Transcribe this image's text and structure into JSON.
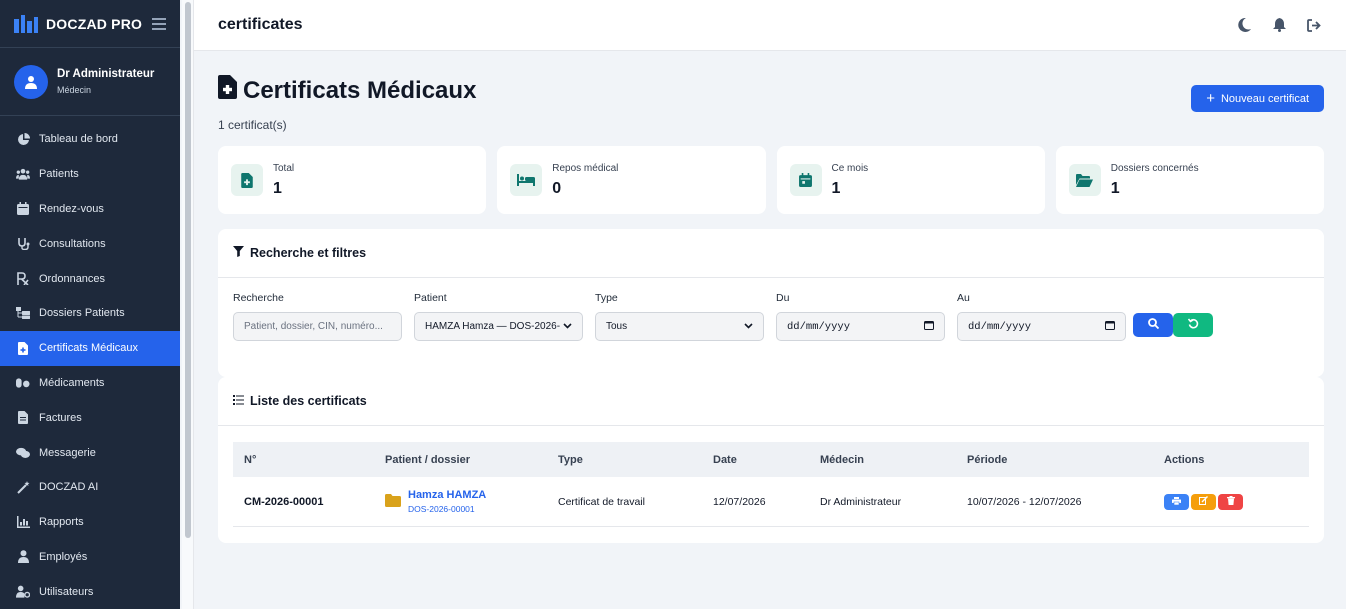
{
  "app": {
    "name": "DOCZAD PRO"
  },
  "user": {
    "name": "Dr Administrateur",
    "role": "Médecin"
  },
  "nav": [
    {
      "label": "Tableau de bord",
      "icon": "chart-pie-icon"
    },
    {
      "label": "Patients",
      "icon": "users-icon"
    },
    {
      "label": "Rendez-vous",
      "icon": "calendar-icon"
    },
    {
      "label": "Consultations",
      "icon": "stethoscope-icon"
    },
    {
      "label": "Ordonnances",
      "icon": "prescription-icon"
    },
    {
      "label": "Dossiers Patients",
      "icon": "folder-tree-icon"
    },
    {
      "label": "Certificats Médicaux",
      "icon": "file-medical-icon",
      "active": true
    },
    {
      "label": "Médicaments",
      "icon": "pills-icon"
    },
    {
      "label": "Factures",
      "icon": "invoice-icon"
    },
    {
      "label": "Messagerie",
      "icon": "comments-icon"
    },
    {
      "label": "DOCZAD AI",
      "icon": "magic-wand-icon"
    },
    {
      "label": "Rapports",
      "icon": "chart-bar-icon"
    },
    {
      "label": "Employés",
      "icon": "user-icon"
    },
    {
      "label": "Utilisateurs",
      "icon": "user-gear-icon"
    }
  ],
  "topbar": {
    "title": "certificates"
  },
  "page": {
    "title": "Certificats Médicaux",
    "subtitle": "1 certificat(s)",
    "new_button": "Nouveau certificat"
  },
  "stats": [
    {
      "label": "Total",
      "value": "1",
      "icon": "file-medical-icon"
    },
    {
      "label": "Repos médical",
      "value": "0",
      "icon": "bed-icon"
    },
    {
      "label": "Ce mois",
      "value": "1",
      "icon": "calendar-icon"
    },
    {
      "label": "Dossiers concernés",
      "value": "1",
      "icon": "folder-open-icon"
    }
  ],
  "filters": {
    "title": "Recherche et filtres",
    "search_label": "Recherche",
    "search_placeholder": "Patient, dossier, CIN, numéro...",
    "patient_label": "Patient",
    "patient_value": "HAMZA Hamza — DOS-2026-",
    "type_label": "Type",
    "type_value": "Tous",
    "from_label": "Du",
    "from_value": "dd/mm/yyyy",
    "to_label": "Au",
    "to_value": "dd/mm/yyyy"
  },
  "list": {
    "title": "Liste des certificats",
    "columns": [
      "N°",
      "Patient / dossier",
      "Type",
      "Date",
      "Médecin",
      "Période",
      "Actions"
    ],
    "rows": [
      {
        "number": "CM-2026-00001",
        "patient": "Hamza HAMZA",
        "dossier": "DOS-2026-00001",
        "type": "Certificat de travail",
        "date": "12/07/2026",
        "doctor": "Dr Administrateur",
        "period": "10/07/2026 - 12/07/2026"
      }
    ]
  },
  "colors": {
    "primary": "#2563eb",
    "sidebar": "#1e293b",
    "success": "#10b981",
    "warning": "#f59e0b",
    "danger": "#ef4444",
    "teal": "#0f766e"
  }
}
